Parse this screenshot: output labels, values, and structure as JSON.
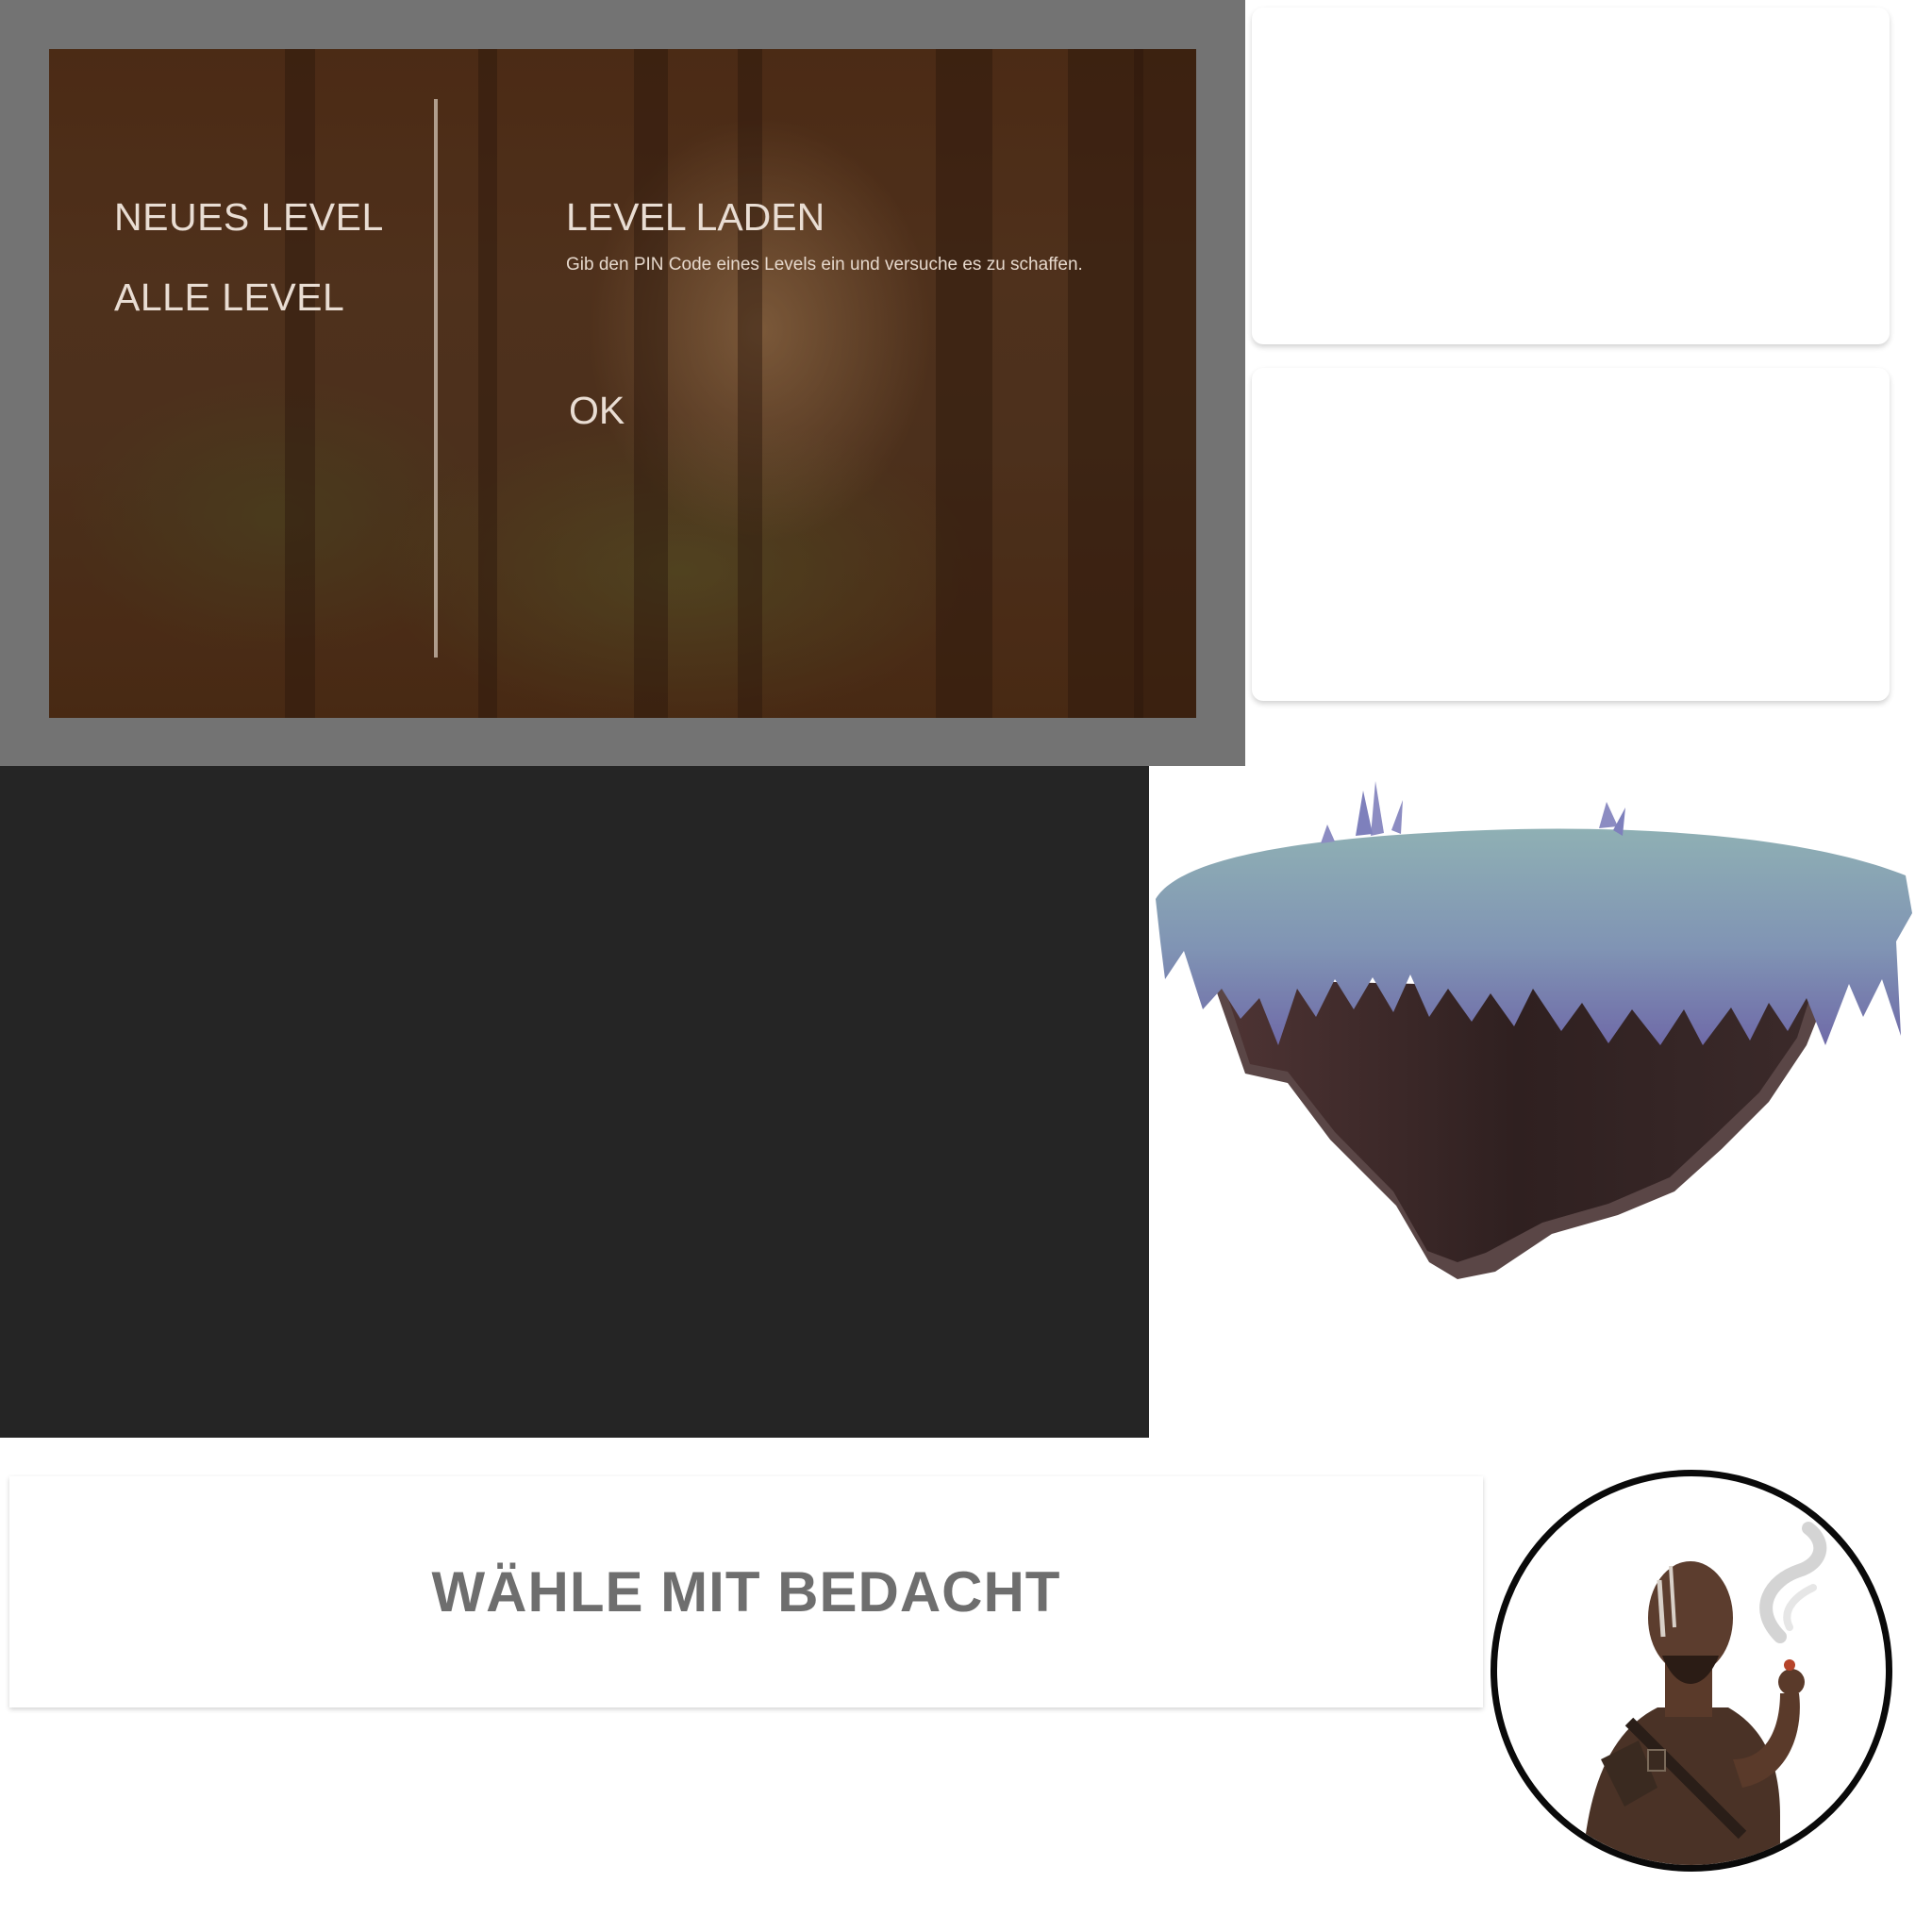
{
  "menu": {
    "new_level": "NEUES LEVEL",
    "all_levels": "ALLE LEVEL"
  },
  "load_level": {
    "title": "LEVEL LADEN",
    "description": "Gib den PIN Code eines Levels ein und versuche es zu schaffen.",
    "ok_label": "OK"
  },
  "banner": {
    "text": "WÄHLE MIT BEDACHT"
  },
  "colors": {
    "frame_gray": "#737373",
    "menu_text": "#e9ddd3",
    "dark_panel": "#252525",
    "banner_text": "#6e6e6e",
    "island_top": "#8aa2b4",
    "island_bottom": "#3b2a2a"
  },
  "icons": {
    "background": "forest-background-image",
    "island": "floating-island-image",
    "portrait": "character-portrait-image"
  }
}
